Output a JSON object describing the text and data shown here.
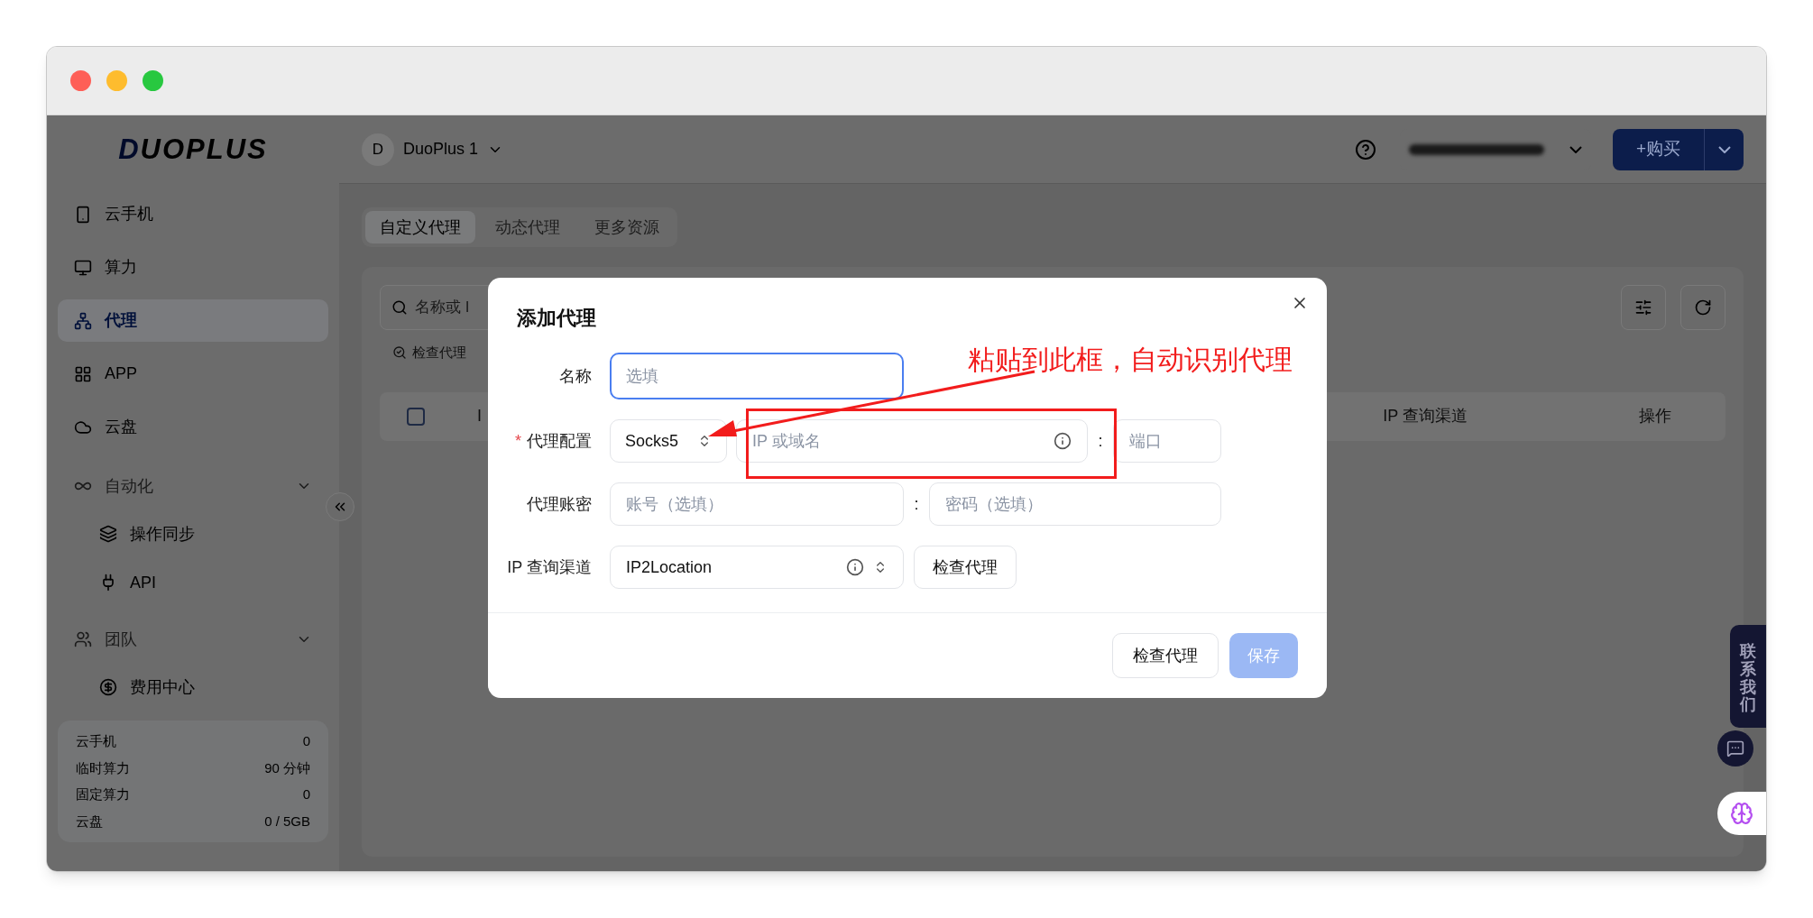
{
  "logo": "DUOPLUS",
  "workspace": {
    "avatar": "D",
    "name": "DuoPlus 1"
  },
  "sidebar": {
    "items": [
      {
        "kind": "nav",
        "label": "云手机",
        "selected": false
      },
      {
        "kind": "nav",
        "label": "算力",
        "selected": false
      },
      {
        "kind": "nav",
        "label": "代理",
        "selected": true
      },
      {
        "kind": "nav",
        "label": "APP",
        "selected": false
      },
      {
        "kind": "nav",
        "label": "云盘",
        "selected": false
      },
      {
        "kind": "group",
        "label": "自动化",
        "expanded": true,
        "children": [
          {
            "label": "操作同步"
          },
          {
            "label": "API"
          }
        ]
      },
      {
        "kind": "group",
        "label": "团队",
        "expanded": true,
        "children": [
          {
            "label": "费用中心"
          }
        ]
      }
    ],
    "stats": [
      {
        "label": "云手机",
        "value": "0"
      },
      {
        "label": "临时算力",
        "value": "90 分钟"
      },
      {
        "label": "固定算力",
        "value": "0"
      },
      {
        "label": "云盘",
        "value": "0 / 5GB"
      }
    ]
  },
  "header": {
    "buy_button": "+购买"
  },
  "tabs": [
    {
      "label": "自定义代理",
      "selected": true
    },
    {
      "label": "动态代理",
      "selected": false
    },
    {
      "label": "更多资源",
      "selected": false
    }
  ],
  "search": {
    "placeholder": "名称或 I"
  },
  "check_proxy_link": "检查代理",
  "table": {
    "select_all": {
      "checked": false
    },
    "columns": [
      "I",
      "IP 查询渠道",
      "操作"
    ]
  },
  "dialog": {
    "title": "添加代理",
    "name": {
      "label": "名称",
      "placeholder": "选填"
    },
    "proxy_config": {
      "required_mark": "*",
      "label": "代理配置",
      "protocol": "Socks5",
      "host_placeholder": "IP 或域名",
      "separator": ":",
      "port_placeholder": "端口"
    },
    "credentials": {
      "label": "代理账密",
      "account_placeholder": "账号（选填）",
      "separator": ":",
      "password_placeholder": "密码（选填）"
    },
    "ip_channel": {
      "label": "IP 查询渠道",
      "value": "IP2Location",
      "check_button": "检查代理"
    },
    "footer": {
      "check_button": "检查代理",
      "save_button": "保存",
      "save_disabled": true
    }
  },
  "annotation": {
    "text": "粘贴到此框，自动识别代理"
  },
  "contact_tab": "联系我们"
}
